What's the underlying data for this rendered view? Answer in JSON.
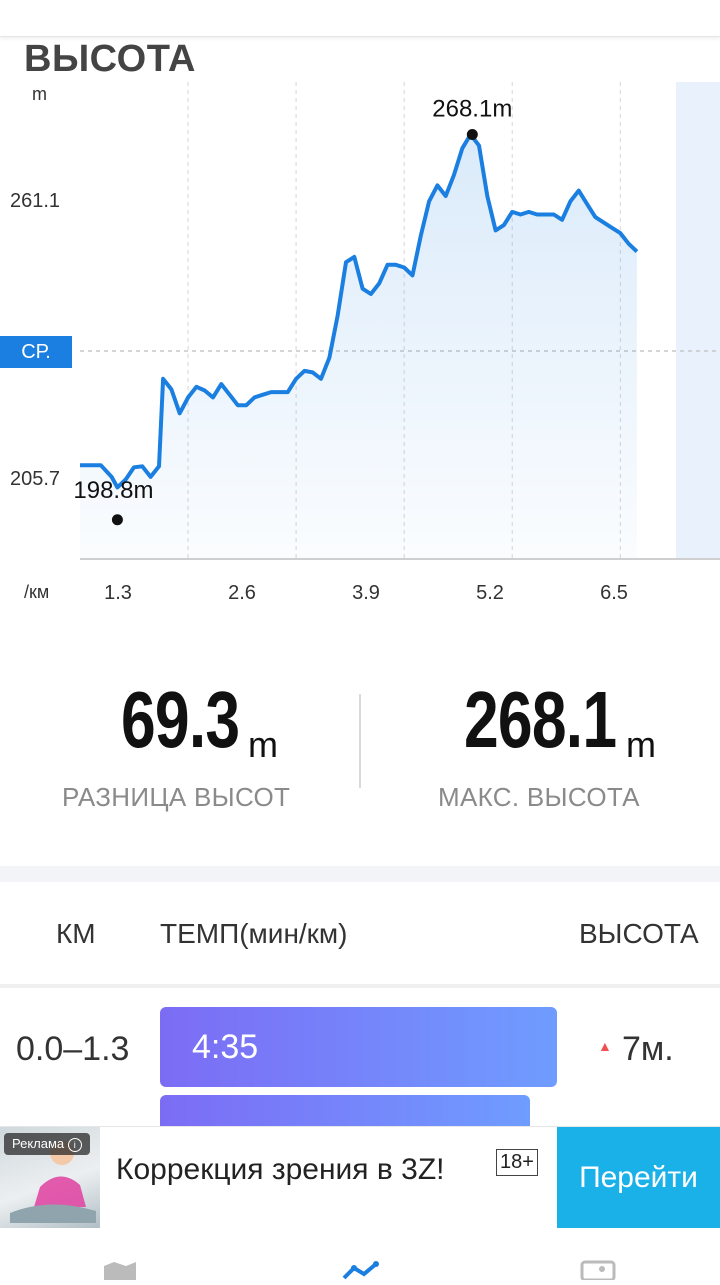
{
  "header": {
    "title": "ВЫСОТА"
  },
  "chart_data": {
    "type": "area",
    "title": "ВЫСОТА",
    "ylabel": "m",
    "xlabel": "/км",
    "y_tick_labels": [
      "261.1",
      "205.7"
    ],
    "x_tick_labels": [
      "1.3",
      "2.6",
      "3.9",
      "5.2",
      "6.5"
    ],
    "avg_label": "СР.",
    "ylim": [
      188,
      278
    ],
    "xlim": [
      0,
      7.7
    ],
    "min_label": "198.8m",
    "max_label": "268.1m",
    "min_point": {
      "x": 0.45,
      "y": 198.8
    },
    "max_point": {
      "x": 4.72,
      "y": 268.1
    },
    "avg_value": 234.1,
    "series": [
      {
        "values": [
          [
            0.0,
            205.7
          ],
          [
            0.25,
            205.7
          ],
          [
            0.38,
            203.5
          ],
          [
            0.45,
            201.5
          ],
          [
            0.55,
            203.0
          ],
          [
            0.65,
            205.3
          ],
          [
            0.75,
            205.5
          ],
          [
            0.85,
            203.5
          ],
          [
            0.95,
            205.5
          ],
          [
            1.0,
            222.0
          ],
          [
            1.1,
            220.0
          ],
          [
            1.2,
            215.5
          ],
          [
            1.3,
            218.5
          ],
          [
            1.4,
            220.5
          ],
          [
            1.5,
            219.8
          ],
          [
            1.6,
            218.5
          ],
          [
            1.7,
            221.0
          ],
          [
            1.8,
            219.0
          ],
          [
            1.9,
            217.0
          ],
          [
            2.0,
            217.0
          ],
          [
            2.1,
            218.5
          ],
          [
            2.2,
            219.0
          ],
          [
            2.3,
            219.5
          ],
          [
            2.4,
            219.5
          ],
          [
            2.5,
            219.5
          ],
          [
            2.6,
            222.0
          ],
          [
            2.7,
            223.5
          ],
          [
            2.8,
            223.2
          ],
          [
            2.9,
            222.0
          ],
          [
            3.0,
            226.0
          ],
          [
            3.1,
            234.0
          ],
          [
            3.2,
            244.0
          ],
          [
            3.3,
            245.0
          ],
          [
            3.4,
            239.0
          ],
          [
            3.5,
            238.0
          ],
          [
            3.6,
            240.0
          ],
          [
            3.7,
            243.5
          ],
          [
            3.8,
            243.5
          ],
          [
            3.9,
            243.0
          ],
          [
            4.0,
            241.5
          ],
          [
            4.1,
            249.0
          ],
          [
            4.2,
            255.5
          ],
          [
            4.3,
            258.5
          ],
          [
            4.4,
            256.5
          ],
          [
            4.5,
            260.5
          ],
          [
            4.6,
            265.5
          ],
          [
            4.7,
            268.1
          ],
          [
            4.8,
            266.0
          ],
          [
            4.9,
            256.5
          ],
          [
            5.0,
            250.0
          ],
          [
            5.1,
            251.0
          ],
          [
            5.2,
            253.5
          ],
          [
            5.3,
            253.0
          ],
          [
            5.4,
            253.5
          ],
          [
            5.5,
            253.0
          ],
          [
            5.6,
            253.0
          ],
          [
            5.7,
            253.0
          ],
          [
            5.8,
            252.0
          ],
          [
            5.9,
            255.5
          ],
          [
            6.0,
            257.5
          ],
          [
            6.1,
            255.0
          ],
          [
            6.2,
            252.5
          ],
          [
            6.3,
            251.5
          ],
          [
            6.4,
            250.5
          ],
          [
            6.5,
            249.5
          ],
          [
            6.6,
            247.5
          ],
          [
            6.7,
            246.0
          ]
        ]
      }
    ]
  },
  "stats": {
    "diff": {
      "value": "69.3",
      "unit": "m",
      "label": "РАЗНИЦА ВЫСОТ"
    },
    "max": {
      "value": "268.1",
      "unit": "m",
      "label": "МАКС. ВЫСОТА"
    }
  },
  "table": {
    "headers": {
      "km": "КМ",
      "pace": "ТЕМП(мин/км)",
      "alt": "ВЫСОТА"
    },
    "rows": [
      {
        "km": "0.0–1.3",
        "pace": "4:35",
        "pace_fraction": 1.0,
        "alt": "7м."
      }
    ]
  },
  "ad": {
    "badge": "Реклама",
    "text": "Коррекция зрения в 3Z!",
    "age": "18+",
    "button": "Перейти"
  },
  "colors": {
    "line": "#1a7fe0",
    "accent": "#1ab0e8"
  }
}
